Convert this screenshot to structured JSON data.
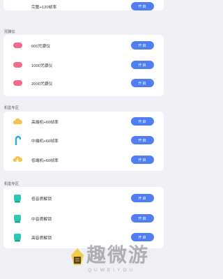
{
  "top_row": {
    "label": "完整+120帧率",
    "button": "开启"
  },
  "section1": {
    "title": "咒骤仪",
    "items": [
      {
        "label": "600咒骤仪",
        "button": "开启"
      },
      {
        "label": "1000咒骤仪",
        "button": "开启"
      },
      {
        "label": "2000咒骤仪",
        "button": "开启"
      }
    ]
  },
  "section2": {
    "title": "机型专区",
    "items": [
      {
        "label": "高端机+60帧率",
        "button": "开启"
      },
      {
        "label": "中端机+60帧率",
        "button": "开启"
      },
      {
        "label": "低端机+60帧率",
        "button": "开启"
      }
    ]
  },
  "section3": {
    "title": "机型专区",
    "items": [
      {
        "label": "低音质解锁",
        "button": "开启"
      },
      {
        "label": "中音质解锁",
        "button": "开启"
      },
      {
        "label": "高音质解锁",
        "button": "开启"
      }
    ]
  },
  "watermark": {
    "text": "趣微游",
    "sub": "QUWEIYOU"
  },
  "colors": {
    "accent": "#4f7ef3",
    "pink": "#f36b8f",
    "teal": "#2fc8b5",
    "yellow": "#f7c24a",
    "cyan": "#2aa8e8",
    "background": "#eef0f5"
  }
}
